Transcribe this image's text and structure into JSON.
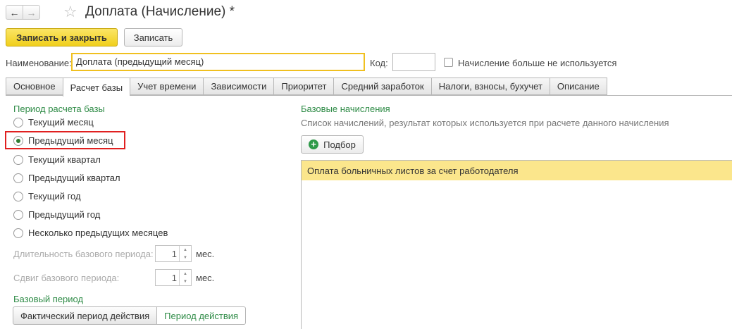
{
  "window": {
    "title": "Доплата (Начисление) *",
    "back_icon": "←",
    "forward_icon": "→",
    "favorite_icon": "☆"
  },
  "toolbar": {
    "save_close_label": "Записать и закрыть",
    "save_label": "Записать"
  },
  "form": {
    "name_label": "Наименование:",
    "name_value": "Доплата (предыдущий месяц)",
    "code_label": "Код:",
    "code_value": "",
    "unused_label": "Начисление больше не используется",
    "unused_checked": false
  },
  "tabs": [
    {
      "label": "Основное"
    },
    {
      "label": "Расчет базы",
      "active": true
    },
    {
      "label": "Учет времени"
    },
    {
      "label": "Зависимости"
    },
    {
      "label": "Приоритет"
    },
    {
      "label": "Средний заработок"
    },
    {
      "label": "Налоги, взносы, бухучет"
    },
    {
      "label": "Описание"
    }
  ],
  "period": {
    "title": "Период расчета базы",
    "options": [
      {
        "label": "Текущий месяц",
        "selected": false
      },
      {
        "label": "Предыдущий месяц",
        "selected": true
      },
      {
        "label": "Текущий квартал",
        "selected": false
      },
      {
        "label": "Предыдущий квартал",
        "selected": false
      },
      {
        "label": "Текущий год",
        "selected": false
      },
      {
        "label": "Предыдущий год",
        "selected": false
      },
      {
        "label": "Несколько предыдущих месяцев",
        "selected": false
      }
    ],
    "duration_label": "Длительность базового периода:",
    "duration_value": "1",
    "duration_unit": "мес.",
    "shift_label": "Сдвиг базового периода:",
    "shift_value": "1",
    "shift_unit": "мес."
  },
  "base_period": {
    "title": "Базовый период",
    "option_actual": "Фактический период действия",
    "option_period": "Период действия"
  },
  "base_accruals": {
    "title": "Базовые начисления",
    "hint": "Список начислений, результат которых используется при расчете данного начисления",
    "pick_label": "Подбор",
    "items": [
      "Оплата больничных листов за счет работодателя"
    ]
  },
  "colors": {
    "accent_green": "#2e8b46",
    "primary_button": "#f0cf1c",
    "highlight_row": "#fbe68c",
    "annotation_red": "#e02020"
  }
}
